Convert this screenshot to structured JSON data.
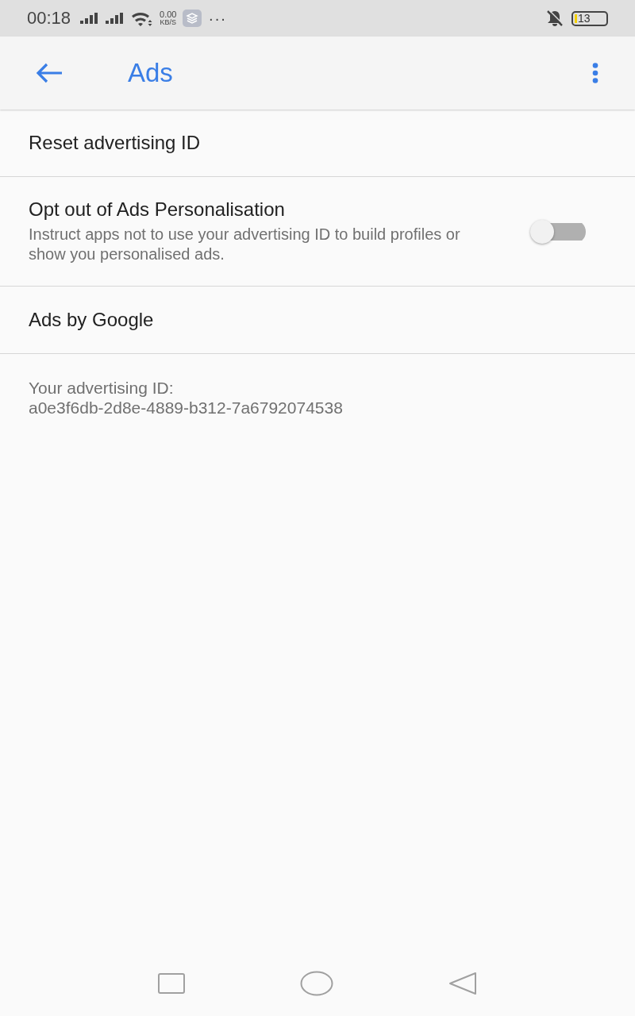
{
  "status_bar": {
    "time": "00:18",
    "speed_value": "0.00",
    "speed_unit": "KB/S",
    "more": "···",
    "battery": "13"
  },
  "app_bar": {
    "title": "Ads"
  },
  "items": [
    {
      "kind": "plain",
      "title": "Reset advertising ID"
    },
    {
      "kind": "switch",
      "title": "Opt out of Ads Personalisation",
      "summary": "Instruct apps not to use your advertising ID to build profiles or show you personalised ads.",
      "on": false
    },
    {
      "kind": "plain",
      "title": "Ads by Google"
    }
  ],
  "footer": {
    "label": "Your advertising ID:",
    "value": "a0e3f6db-2d8e-4889-b312-7a6792074538"
  }
}
